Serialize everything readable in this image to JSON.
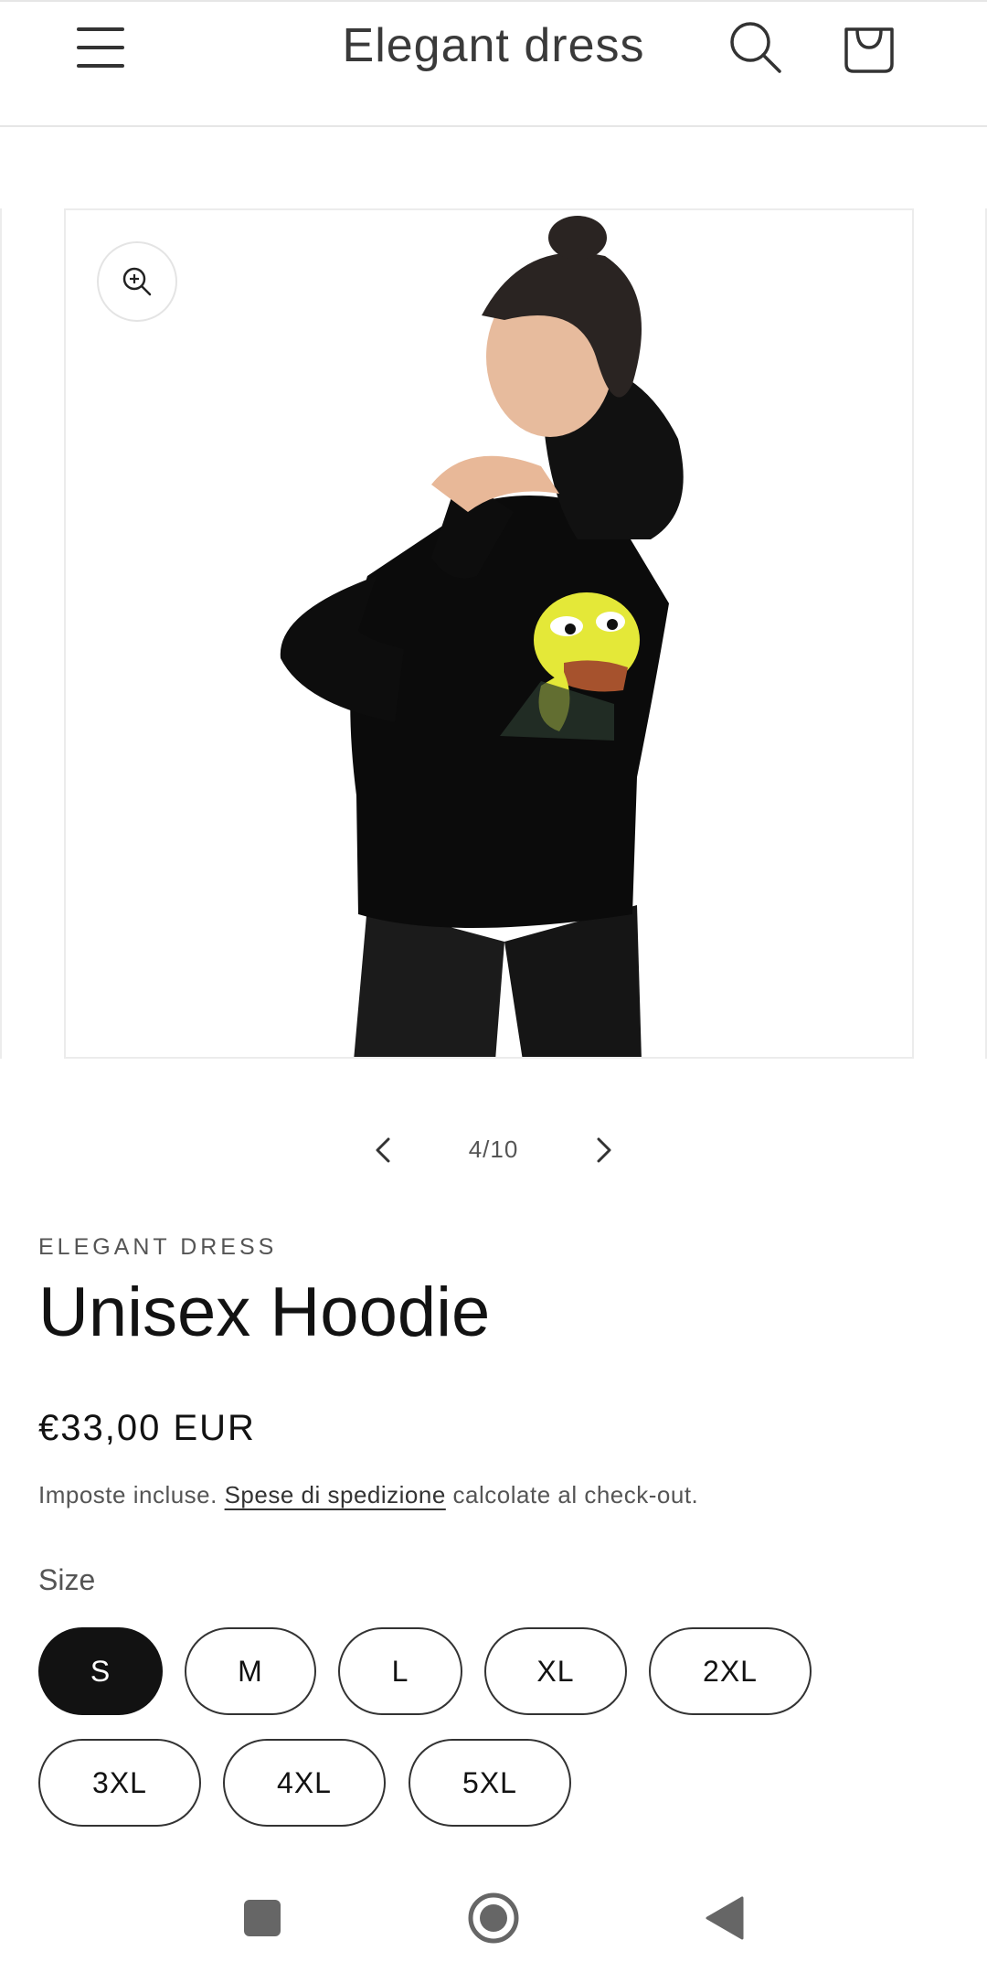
{
  "header": {
    "title": "Elegant dress",
    "menu_icon": "hamburger-menu-icon",
    "search_icon": "search-icon",
    "cart_icon": "shopping-bag-icon"
  },
  "gallery": {
    "current": 4,
    "total": 10,
    "counter_text": "4/10",
    "zoom_icon": "zoom-in-icon",
    "image_subject": "woman wearing black hoodie with yellow frog print on back"
  },
  "product": {
    "vendor": "ELEGANT DRESS",
    "title": "Unisex Hoodie",
    "price": "€33,00 EUR",
    "tax_prefix": "Imposte incluse. ",
    "shipping_link": "Spese di spedizione",
    "tax_suffix": " calcolate al check-out."
  },
  "size": {
    "label": "Size",
    "selected": "S",
    "options": [
      "S",
      "M",
      "L",
      "XL",
      "2XL",
      "3XL",
      "4XL",
      "5XL"
    ]
  },
  "system_nav": {
    "recents_icon": "square-recents-icon",
    "home_icon": "circle-home-icon",
    "back_icon": "triangle-back-icon"
  }
}
